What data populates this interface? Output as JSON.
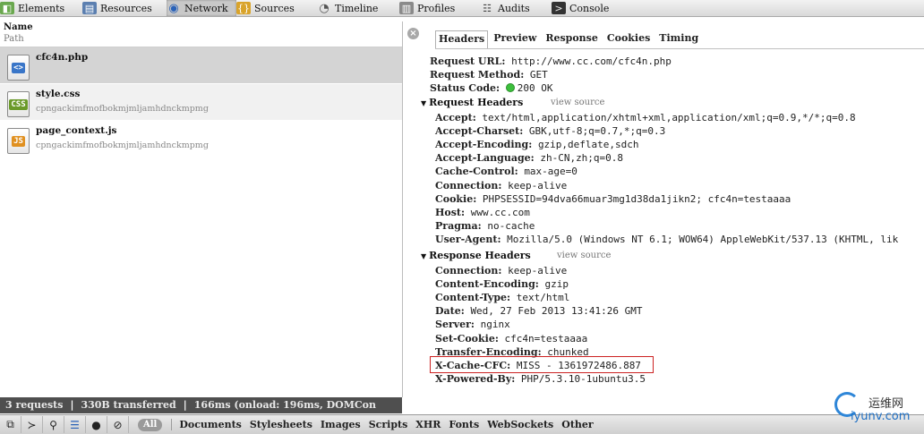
{
  "toolbar": {
    "tabs": [
      {
        "label": "Elements",
        "icon": "elements-icon"
      },
      {
        "label": "Resources",
        "icon": "resources-icon"
      },
      {
        "label": "Network",
        "icon": "network-icon",
        "active": true
      },
      {
        "label": "Sources",
        "icon": "sources-icon"
      },
      {
        "label": "Timeline",
        "icon": "timeline-icon"
      },
      {
        "label": "Profiles",
        "icon": "profiles-icon"
      },
      {
        "label": "Audits",
        "icon": "audits-icon"
      },
      {
        "label": "Console",
        "icon": "console-icon"
      }
    ]
  },
  "left": {
    "col_name": "Name",
    "col_path": "Path",
    "files": [
      {
        "name": "cfc4n.php",
        "path": "",
        "type_badge": "<>",
        "badge_color": "#3a76c8"
      },
      {
        "name": "style.css",
        "path": "cpngackimfmofbokmjmljamhdnckmpmg",
        "type_badge": "CSS",
        "badge_color": "#6a9a2a"
      },
      {
        "name": "page_context.js",
        "path": "cpngackimfmofbokmjmljamhdnckmpmg",
        "type_badge": "JS",
        "badge_color": "#e09020"
      }
    ]
  },
  "status": {
    "requests": "3 requests",
    "transferred": "330B transferred",
    "timing": "166ms (onload: 196ms, DOMCon"
  },
  "bottom": {
    "all_label": "All",
    "filters": [
      "Documents",
      "Stylesheets",
      "Images",
      "Scripts",
      "XHR",
      "Fonts",
      "WebSockets",
      "Other"
    ]
  },
  "detail": {
    "tabs": [
      "Headers",
      "Preview",
      "Response",
      "Cookies",
      "Timing"
    ],
    "active_tab": "Headers",
    "general": [
      {
        "k": "Request URL:",
        "v": "http://www.cc.com/cfc4n.php"
      },
      {
        "k": "Request Method:",
        "v": "GET"
      },
      {
        "k": "Status Code:",
        "v": "200 OK"
      }
    ],
    "request_headers_title": "Request Headers",
    "view_source": "view source",
    "request_headers": [
      {
        "k": "Accept:",
        "v": "text/html,application/xhtml+xml,application/xml;q=0.9,*/*;q=0.8"
      },
      {
        "k": "Accept-Charset:",
        "v": "GBK,utf-8;q=0.7,*;q=0.3"
      },
      {
        "k": "Accept-Encoding:",
        "v": "gzip,deflate,sdch"
      },
      {
        "k": "Accept-Language:",
        "v": "zh-CN,zh;q=0.8"
      },
      {
        "k": "Cache-Control:",
        "v": "max-age=0"
      },
      {
        "k": "Connection:",
        "v": "keep-alive"
      },
      {
        "k": "Cookie:",
        "v": "PHPSESSID=94dva66muar3mg1d38da1jikn2; cfc4n=testaaaa"
      },
      {
        "k": "Host:",
        "v": "www.cc.com"
      },
      {
        "k": "Pragma:",
        "v": "no-cache"
      },
      {
        "k": "User-Agent:",
        "v": "Mozilla/5.0 (Windows NT 6.1; WOW64) AppleWebKit/537.13 (KHTML, lik"
      }
    ],
    "response_headers_title": "Response Headers",
    "response_headers": [
      {
        "k": "Connection:",
        "v": "keep-alive"
      },
      {
        "k": "Content-Encoding:",
        "v": "gzip"
      },
      {
        "k": "Content-Type:",
        "v": "text/html"
      },
      {
        "k": "Date:",
        "v": "Wed, 27 Feb 2013 13:41:26 GMT"
      },
      {
        "k": "Server:",
        "v": "nginx"
      },
      {
        "k": "Set-Cookie:",
        "v": "cfc4n=testaaaa"
      },
      {
        "k": "Transfer-Encoding:",
        "v": "chunked"
      },
      {
        "k": "X-Cache-CFC:",
        "v": "MISS - 1361972486.887"
      },
      {
        "k": "X-Powered-By:",
        "v": "PHP/5.3.10-1ubuntu3.5"
      }
    ]
  },
  "watermark": {
    "line1": "运维网",
    "line2": "iyunv.com"
  }
}
